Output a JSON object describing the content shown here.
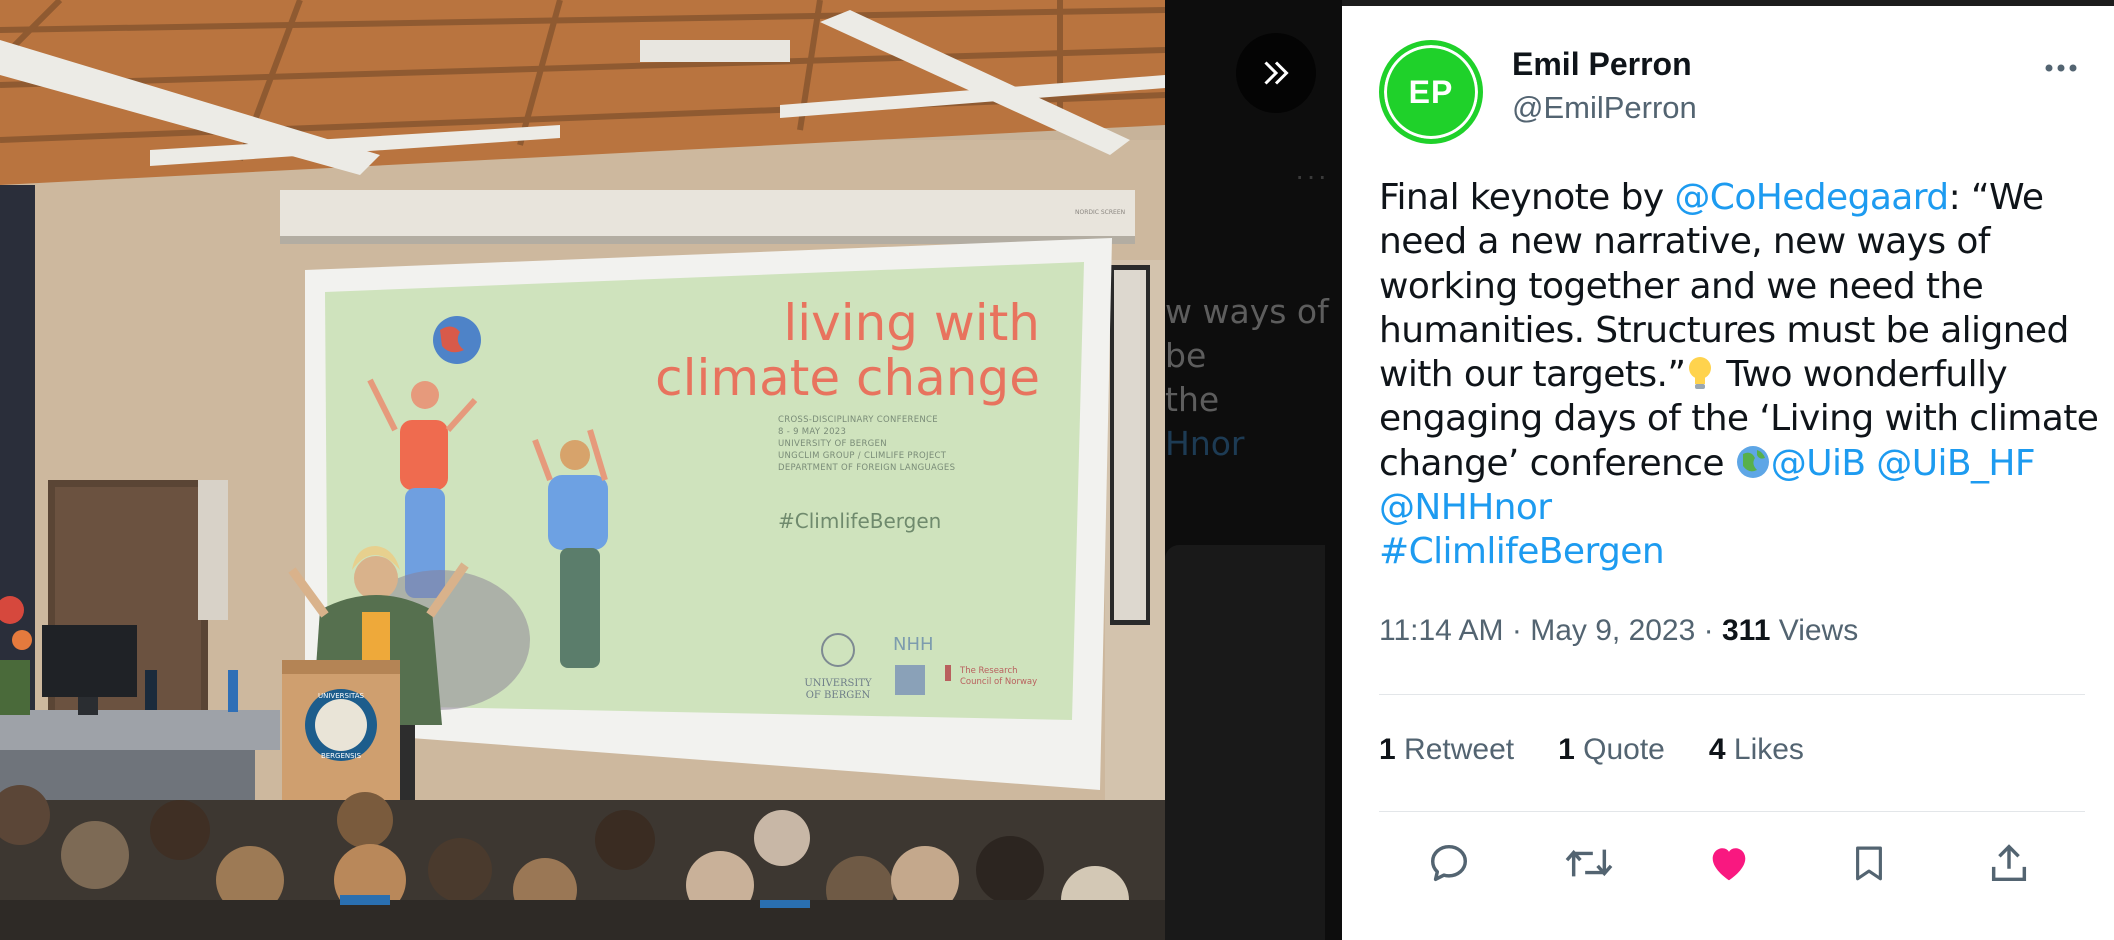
{
  "tweet": {
    "avatar_initials": "EP",
    "display_name": "Emil Perron",
    "handle": "@EmilPerron",
    "body": {
      "l1_a": "Final keynote by ",
      "l1_mention": "@CoHedegaard",
      "l1_b": ": “We",
      "l2": "need a new narrative, new ways of",
      "l3": "working together and we need the",
      "l4": "humanities. Structures must be aligned",
      "l5_a": "with our targets.”",
      "l5_b": " Two wonderfully",
      "l6": "engaging days of the ‘Living with climate",
      "l7_a": "change’ conference ",
      "mention_uib": "@UiB",
      "mention_uib_hf": "@UiB_HF",
      "mention_nhh": "@NHHnor",
      "hashtag": "#ClimlifeBergen"
    },
    "time": "11:14 AM",
    "date": "May 9, 2023",
    "views_count": "311",
    "views_label": "Views",
    "stats": {
      "retweets_count": "1",
      "retweets_label": "Retweet",
      "quotes_count": "1",
      "quotes_label": "Quote",
      "likes_count": "4",
      "likes_label": "Likes"
    },
    "liked": true,
    "colors": {
      "link": "#1d9bf0",
      "like": "#f91880",
      "avatar": "#1fd12a"
    }
  },
  "background_fragments": {
    "l1": "w ways of",
    "l2": " be",
    "l3": "the",
    "l4": "Hnor"
  },
  "slide": {
    "title_line1": "living with",
    "title_line2": "climate change",
    "subtitle_lines": [
      "CROSS-DISCIPLINARY CONFERENCE",
      "8 - 9 MAY 2023",
      "UNIVERSITY OF BERGEN",
      "UNGCLIM GROUP / CLIMLIFE PROJECT",
      "DEPARTMENT OF FOREIGN LANGUAGES"
    ],
    "hashtag": "#ClimlifeBergen",
    "logo_uib_line1": "UNIVERSITY",
    "logo_uib_line2": "OF BERGEN",
    "logo_nhh": "NHH",
    "logo_rcn_line1": "The Research",
    "logo_rcn_line2": "Council of Norway",
    "projector_brand": "NORDIC SCREEN"
  },
  "lectern_seal": {
    "top": "UNIVERSITAS",
    "bottom": "BERGENSIS"
  },
  "icons": {
    "expand": "double-chevron-right-icon",
    "more": "more-horizontal-icon",
    "reply": "reply-icon",
    "retweet": "retweet-icon",
    "like": "heart-filled-icon",
    "bookmark": "bookmark-icon",
    "share": "share-icon"
  }
}
